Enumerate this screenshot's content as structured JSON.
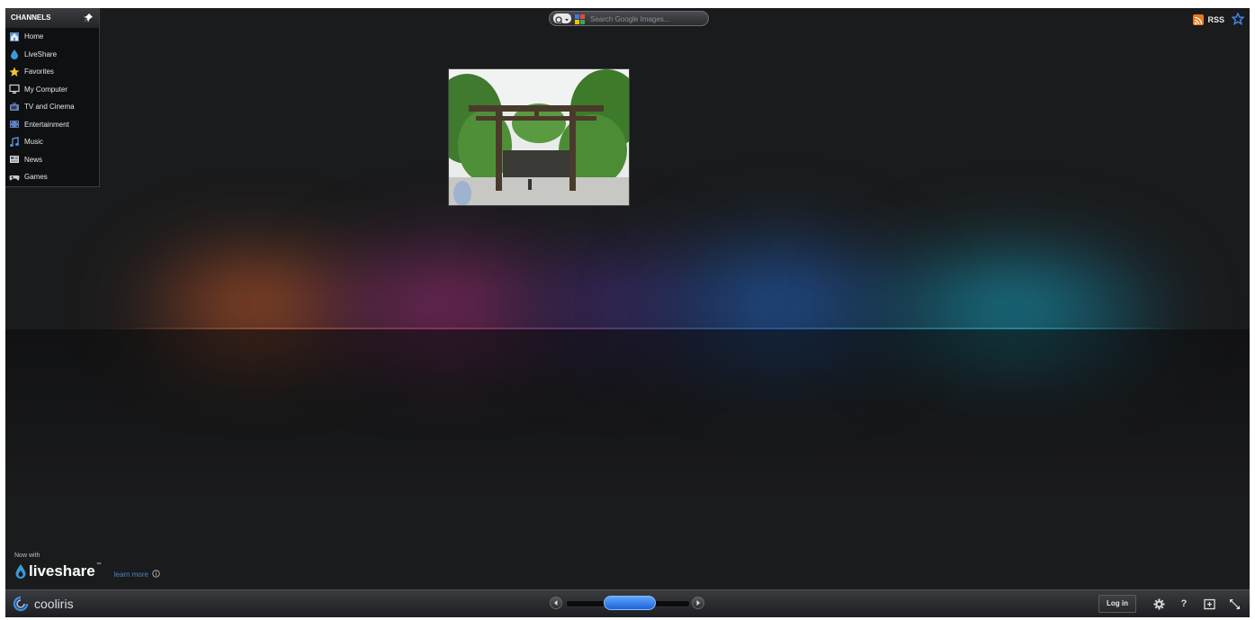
{
  "channels": {
    "header": "CHANNELS",
    "items": [
      {
        "label": "Home",
        "icon": "home-icon"
      },
      {
        "label": "LiveShare",
        "icon": "liveshare-drop-icon"
      },
      {
        "label": "Favorites",
        "icon": "star-icon"
      },
      {
        "label": "My Computer",
        "icon": "monitor-icon"
      },
      {
        "label": "TV and Cinema",
        "icon": "tv-icon"
      },
      {
        "label": "Entertainment",
        "icon": "film-icon"
      },
      {
        "label": "Music",
        "icon": "music-note-icon"
      },
      {
        "label": "News",
        "icon": "newspaper-icon"
      },
      {
        "label": "Games",
        "icon": "gamepad-icon"
      }
    ]
  },
  "search": {
    "placeholder": "Search Google Images..."
  },
  "rss": {
    "label": "RSS"
  },
  "promo": {
    "now_with": "Now with",
    "brand": "liveshare",
    "trademark": "™",
    "learn_more": "learn more"
  },
  "bottombar": {
    "brand": "cooliris",
    "login_label": "Log in",
    "help_label": "?"
  },
  "colors": {
    "accent_blue": "#2f7be0",
    "rss_orange": "#e8791b",
    "background": "#1a1b1c"
  }
}
